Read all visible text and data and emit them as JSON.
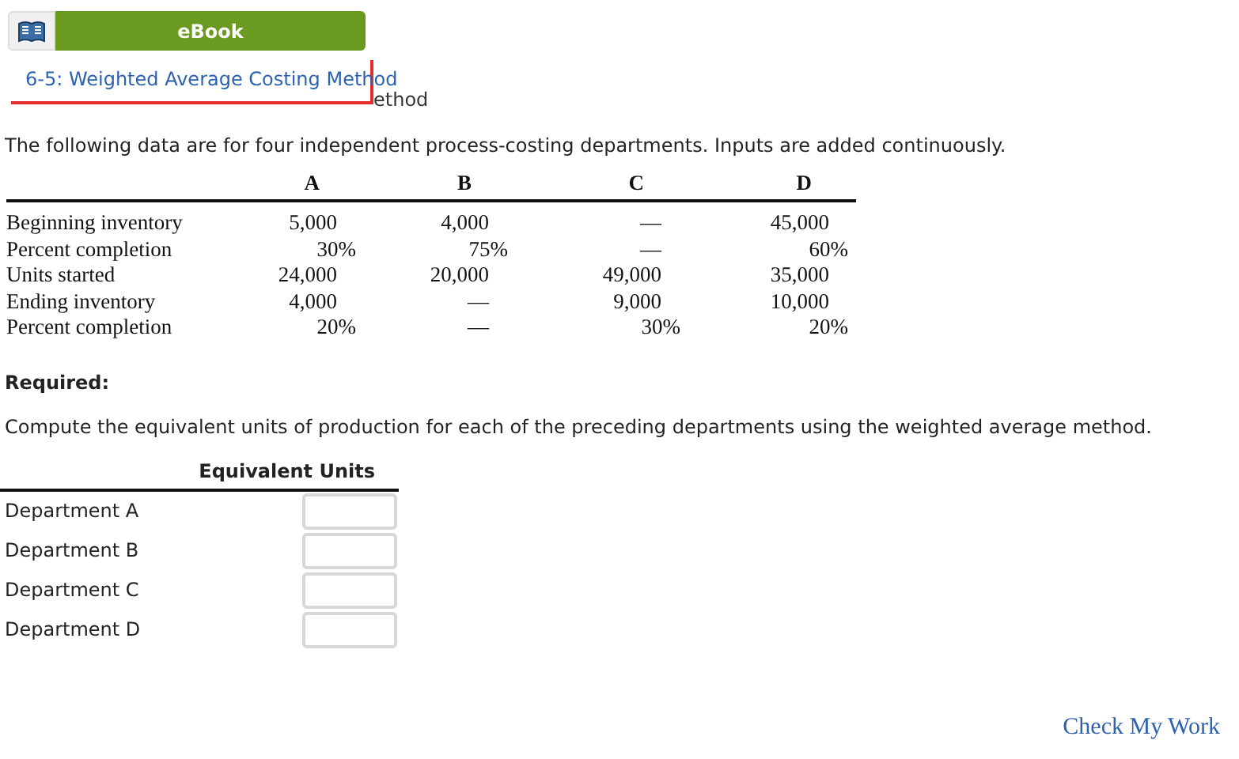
{
  "ebook_button": {
    "label": "eBook"
  },
  "popup_link": {
    "label": "6-5: Weighted Average Costing Method"
  },
  "heading_fragment": "ethod",
  "intro": "The following data are for four independent process-costing departments. Inputs are added continuously.",
  "data_table": {
    "columns": [
      "A",
      "B",
      "C",
      "D"
    ],
    "rows": [
      {
        "label": "Beginning inventory",
        "cells": [
          {
            "text": "5,000",
            "kind": "num"
          },
          {
            "text": "4,000",
            "kind": "num"
          },
          {
            "text": "—",
            "kind": "num"
          },
          {
            "text": "45,000",
            "kind": "num"
          }
        ]
      },
      {
        "label": "Percent completion",
        "cells": [
          {
            "text": "30%",
            "kind": "pct"
          },
          {
            "text": "75%",
            "kind": "pct"
          },
          {
            "text": "—",
            "kind": "num"
          },
          {
            "text": "60%",
            "kind": "pct"
          }
        ]
      },
      {
        "label": "Units started",
        "cells": [
          {
            "text": "24,000",
            "kind": "num"
          },
          {
            "text": "20,000",
            "kind": "num"
          },
          {
            "text": "49,000",
            "kind": "num"
          },
          {
            "text": "35,000",
            "kind": "num"
          }
        ]
      },
      {
        "label": "Ending inventory",
        "cells": [
          {
            "text": "4,000",
            "kind": "num"
          },
          {
            "text": "—",
            "kind": "num"
          },
          {
            "text": "9,000",
            "kind": "num"
          },
          {
            "text": "10,000",
            "kind": "num"
          }
        ]
      },
      {
        "label": "Percent completion",
        "cells": [
          {
            "text": "20%",
            "kind": "pct"
          },
          {
            "text": "—",
            "kind": "num"
          },
          {
            "text": "30%",
            "kind": "pct"
          },
          {
            "text": "20%",
            "kind": "pct"
          }
        ]
      }
    ]
  },
  "required_label": "Required:",
  "instruction": "Compute the equivalent units of production for each of the preceding departments using the weighted average method.",
  "answer_table": {
    "header": "Equivalent Units",
    "rows": [
      {
        "label": "Department A"
      },
      {
        "label": "Department B"
      },
      {
        "label": "Department C"
      },
      {
        "label": "Department D"
      }
    ]
  },
  "check_button": {
    "label": "Check My Work"
  }
}
